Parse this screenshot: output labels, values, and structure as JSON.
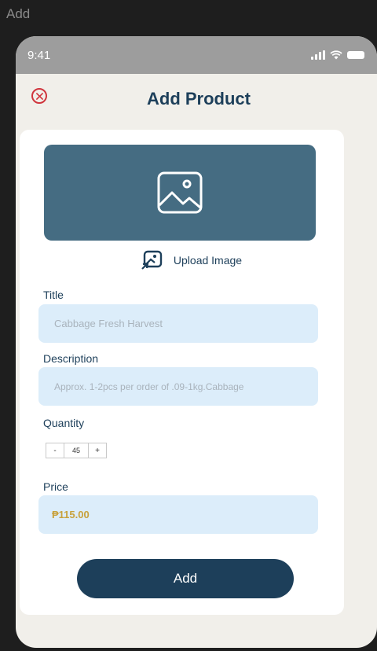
{
  "frame": {
    "title": "Add"
  },
  "status_bar": {
    "time": "9:41",
    "icons": [
      "signal-icon",
      "wifi-icon",
      "battery-icon"
    ]
  },
  "header": {
    "title": "Add Product",
    "close_icon": "close-icon"
  },
  "image_placeholder": {
    "icon": "image-icon"
  },
  "upload": {
    "label": "Upload Image",
    "icon": "upload-image-icon"
  },
  "form": {
    "title_label": "Title",
    "title_placeholder": "Cabbage Fresh Harvest",
    "description_label": "Description",
    "description_placeholder": "Approx. 1-2pcs per order of .09-1kg.Cabbage",
    "quantity_label": "Quantity",
    "quantity": {
      "minus": "-",
      "value": "45",
      "plus": "+"
    },
    "price_label": "Price",
    "price_value": "₱115.00"
  },
  "actions": {
    "add_label": "Add"
  },
  "colors": {
    "primary": "#1d3f5a",
    "accent_close": "#d0353d",
    "field_bg": "#dcedfa",
    "image_bg": "#456c82",
    "price": "#c8a13b"
  }
}
